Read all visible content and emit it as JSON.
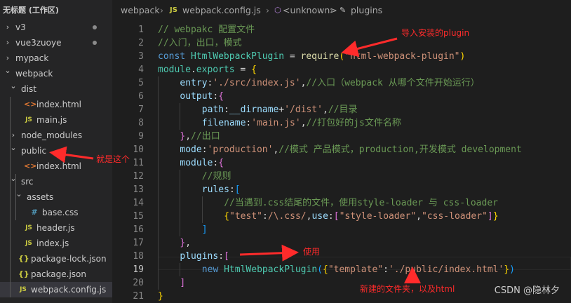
{
  "explorer": {
    "workspace_title": "无标题 (工作区)",
    "items": [
      {
        "label": "v3",
        "type": "folder",
        "state": "collapsed",
        "level": 0,
        "modified": true
      },
      {
        "label": "vue3zuoye",
        "type": "folder",
        "state": "collapsed",
        "level": 0,
        "modified": true
      },
      {
        "label": "mypack",
        "type": "folder",
        "state": "collapsed",
        "level": 0,
        "modified": false
      },
      {
        "label": "webpack",
        "type": "folder",
        "state": "expanded",
        "level": 0,
        "modified": false
      },
      {
        "label": "dist",
        "type": "folder",
        "state": "expanded",
        "level": 1,
        "modified": false
      },
      {
        "label": "index.html",
        "type": "html",
        "level": 2
      },
      {
        "label": "main.js",
        "type": "js",
        "level": 2
      },
      {
        "label": "node_modules",
        "type": "folder",
        "state": "collapsed",
        "level": 1,
        "modified": false
      },
      {
        "label": "public",
        "type": "folder",
        "state": "expanded",
        "level": 1,
        "modified": false
      },
      {
        "label": "index.html",
        "type": "html",
        "level": 2
      },
      {
        "label": "src",
        "type": "folder",
        "state": "expanded",
        "level": 1,
        "modified": false
      },
      {
        "label": "assets",
        "type": "folder",
        "state": "expanded",
        "level": 2,
        "modified": false
      },
      {
        "label": "base.css",
        "type": "css",
        "level": 3
      },
      {
        "label": "header.js",
        "type": "js",
        "level": 2
      },
      {
        "label": "index.js",
        "type": "js",
        "level": 2
      },
      {
        "label": "package-lock.json",
        "type": "json",
        "level": 1
      },
      {
        "label": "package.json",
        "type": "json",
        "level": 1
      },
      {
        "label": "webpack.config.js",
        "type": "js",
        "level": 1,
        "selected": true
      }
    ]
  },
  "breadcrumb": {
    "folder": "webpack",
    "file": "webpack.config.js",
    "symbol1": "<unknown>",
    "symbol2": "plugins"
  },
  "editor": {
    "active_line": 19,
    "line_numbers": [
      "1",
      "2",
      "3",
      "4",
      "5",
      "6",
      "7",
      "8",
      "9",
      "10",
      "11",
      "12",
      "13",
      "14",
      "15",
      "16",
      "17",
      "18",
      "19",
      "20",
      "21"
    ],
    "lines": [
      {
        "indent": 0,
        "tokens": [
          {
            "c": "c-comment",
            "t": "// webpakc 配置文件"
          }
        ]
      },
      {
        "indent": 0,
        "tokens": [
          {
            "c": "c-comment",
            "t": "//入门，出口，模式"
          }
        ]
      },
      {
        "indent": 0,
        "tokens": [
          {
            "c": "c-kw",
            "t": "const "
          },
          {
            "c": "c-class",
            "t": "HtmlWebpackPlugin"
          },
          {
            "c": "c-plain",
            "t": " = "
          },
          {
            "c": "c-fn",
            "t": "require"
          },
          {
            "c": "c-br1",
            "t": "("
          },
          {
            "c": "c-str",
            "t": "\"html-webpack-plugin\""
          },
          {
            "c": "c-br1",
            "t": ")"
          }
        ]
      },
      {
        "indent": 0,
        "tokens": [
          {
            "c": "c-class",
            "t": "module"
          },
          {
            "c": "c-plain",
            "t": "."
          },
          {
            "c": "c-class",
            "t": "exports"
          },
          {
            "c": "c-plain",
            "t": " = "
          },
          {
            "c": "c-br1",
            "t": "{"
          }
        ]
      },
      {
        "indent": 1,
        "tokens": [
          {
            "c": "c-prop",
            "t": "entry"
          },
          {
            "c": "c-plain",
            "t": ":"
          },
          {
            "c": "c-str",
            "t": "'./src/index.js'"
          },
          {
            "c": "c-plain",
            "t": ","
          },
          {
            "c": "c-comment",
            "t": "//入口（webpack 从哪个文件开始运行）"
          }
        ]
      },
      {
        "indent": 1,
        "tokens": [
          {
            "c": "c-prop",
            "t": "output"
          },
          {
            "c": "c-plain",
            "t": ":"
          },
          {
            "c": "c-br2",
            "t": "{"
          }
        ]
      },
      {
        "indent": 2,
        "tokens": [
          {
            "c": "c-prop",
            "t": "path"
          },
          {
            "c": "c-plain",
            "t": ":"
          },
          {
            "c": "c-var",
            "t": "__dirname"
          },
          {
            "c": "c-plain",
            "t": "+"
          },
          {
            "c": "c-str",
            "t": "'/dist'"
          },
          {
            "c": "c-plain",
            "t": ","
          },
          {
            "c": "c-comment",
            "t": "//目录"
          }
        ]
      },
      {
        "indent": 2,
        "tokens": [
          {
            "c": "c-prop",
            "t": "filename"
          },
          {
            "c": "c-plain",
            "t": ":"
          },
          {
            "c": "c-str",
            "t": "'main.js'"
          },
          {
            "c": "c-plain",
            "t": ","
          },
          {
            "c": "c-comment",
            "t": "//打包好的js文件名称"
          }
        ]
      },
      {
        "indent": 1,
        "tokens": [
          {
            "c": "c-br2",
            "t": "}"
          },
          {
            "c": "c-plain",
            "t": ","
          },
          {
            "c": "c-comment",
            "t": "//出口"
          }
        ]
      },
      {
        "indent": 1,
        "tokens": [
          {
            "c": "c-prop",
            "t": "mode"
          },
          {
            "c": "c-plain",
            "t": ":"
          },
          {
            "c": "c-str",
            "t": "'production'"
          },
          {
            "c": "c-plain",
            "t": ","
          },
          {
            "c": "c-comment",
            "t": "//模式 产品模式，production,开发模式 development"
          }
        ]
      },
      {
        "indent": 1,
        "tokens": [
          {
            "c": "c-prop",
            "t": "module"
          },
          {
            "c": "c-plain",
            "t": ":"
          },
          {
            "c": "c-br2",
            "t": "{"
          }
        ]
      },
      {
        "indent": 2,
        "tokens": [
          {
            "c": "c-comment",
            "t": "//规则"
          }
        ]
      },
      {
        "indent": 2,
        "tokens": [
          {
            "c": "c-prop",
            "t": "rules"
          },
          {
            "c": "c-plain",
            "t": ":"
          },
          {
            "c": "c-br3",
            "t": "["
          }
        ]
      },
      {
        "indent": 3,
        "tokens": [
          {
            "c": "c-comment",
            "t": "//当遇到.css结尾的文件，使用style-loader 与 css-loader"
          }
        ]
      },
      {
        "indent": 3,
        "tokens": [
          {
            "c": "c-br1",
            "t": "{"
          },
          {
            "c": "c-str",
            "t": "\"test\""
          },
          {
            "c": "c-plain",
            "t": ":"
          },
          {
            "c": "c-str",
            "t": "/\\.css/"
          },
          {
            "c": "c-plain",
            "t": ","
          },
          {
            "c": "c-prop",
            "t": "use"
          },
          {
            "c": "c-plain",
            "t": ":"
          },
          {
            "c": "c-br2",
            "t": "["
          },
          {
            "c": "c-str",
            "t": "\"style-loader\""
          },
          {
            "c": "c-plain",
            "t": ","
          },
          {
            "c": "c-str",
            "t": "\"css-loader\""
          },
          {
            "c": "c-br2",
            "t": "]"
          },
          {
            "c": "c-br1",
            "t": "}"
          }
        ]
      },
      {
        "indent": 2,
        "tokens": [
          {
            "c": "c-br3",
            "t": "]"
          }
        ]
      },
      {
        "indent": 1,
        "tokens": [
          {
            "c": "c-br2",
            "t": "}"
          },
          {
            "c": "c-plain",
            "t": ","
          }
        ]
      },
      {
        "indent": 1,
        "tokens": [
          {
            "c": "c-prop",
            "t": "plugins"
          },
          {
            "c": "c-plain",
            "t": ":"
          },
          {
            "c": "c-br2",
            "t": "["
          }
        ]
      },
      {
        "indent": 2,
        "tokens": [
          {
            "c": "c-kw",
            "t": "new "
          },
          {
            "c": "c-class",
            "t": "HtmlWebpackPlugin"
          },
          {
            "c": "c-br3",
            "t": "("
          },
          {
            "c": "c-br1",
            "t": "{"
          },
          {
            "c": "c-str",
            "t": "\"template\""
          },
          {
            "c": "c-plain",
            "t": ":"
          },
          {
            "c": "c-str",
            "t": "'./public/index.html'"
          },
          {
            "c": "c-br1",
            "t": "}"
          },
          {
            "c": "c-br3",
            "t": ")"
          }
        ]
      },
      {
        "indent": 1,
        "tokens": [
          {
            "c": "c-br2",
            "t": "]"
          }
        ]
      },
      {
        "indent": 0,
        "tokens": [
          {
            "c": "c-br1",
            "t": "}"
          }
        ]
      }
    ]
  },
  "annotations": {
    "import_plugin": "导入安装的plugin",
    "this_one": "就是这个",
    "use": "使用",
    "new_folder": "新建的文件夹，以及html"
  },
  "watermark": "CSDN @隐林夕",
  "colors": {
    "annotation": "#ff2b2b",
    "sidebar_bg": "#252526",
    "editor_bg": "#1e1e1e",
    "selected_row": "#37373d"
  }
}
